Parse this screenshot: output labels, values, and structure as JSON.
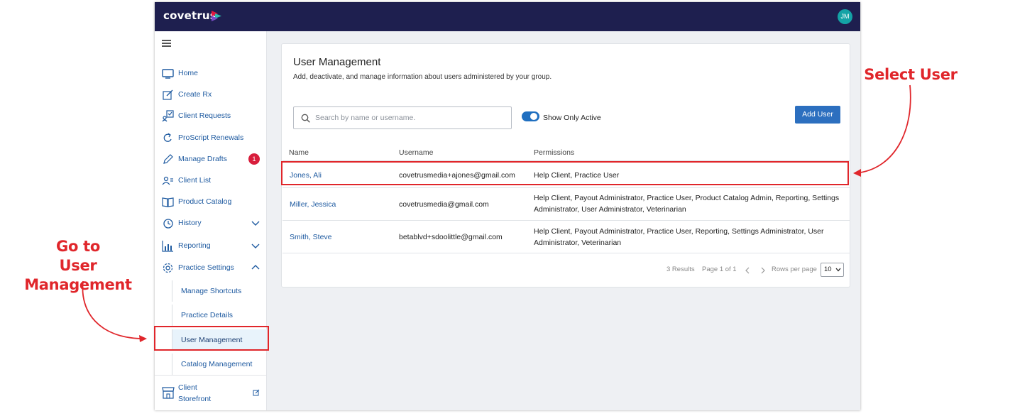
{
  "annotations": {
    "left_callout": "Go to\nUser Management",
    "left_line1": "Go to",
    "left_line2": "User Management",
    "right_callout": "Select User",
    "color": "#e0262b"
  },
  "header": {
    "logo_text": "covetrus",
    "avatar_initials": "JM"
  },
  "sidebar": {
    "items": [
      {
        "label": "Home",
        "icon": "monitor-icon"
      },
      {
        "label": "Create Rx",
        "icon": "edit-icon"
      },
      {
        "label": "Client Requests",
        "icon": "client-requests-icon"
      },
      {
        "label": "ProScript Renewals",
        "icon": "refresh-icon"
      },
      {
        "label": "Manage Drafts",
        "icon": "pencil-icon",
        "badge": "1"
      },
      {
        "label": "Client List",
        "icon": "users-icon"
      },
      {
        "label": "Product Catalog",
        "icon": "book-icon"
      },
      {
        "label": "History",
        "icon": "history-icon",
        "expandable": "chevron-down"
      },
      {
        "label": "Reporting",
        "icon": "bar-chart-icon",
        "expandable": "chevron-down"
      },
      {
        "label": "Practice Settings",
        "icon": "gear-icon",
        "expandable": "chevron-up"
      }
    ],
    "practice_settings_subitems": [
      {
        "label": "Manage Shortcuts"
      },
      {
        "label": "Practice Details"
      },
      {
        "label": "User Management",
        "active": true
      },
      {
        "label": "Catalog Management"
      }
    ],
    "storefront": {
      "label": "Client Storefront",
      "icon": "storefront-icon"
    }
  },
  "main": {
    "title": "User Management",
    "subtitle": "Add, deactivate, and manage information about users administered by your group.",
    "search_placeholder": "Search by name or username.",
    "toggle_label": "Show Only Active",
    "toggle_on": true,
    "add_button": "Add User",
    "table": {
      "columns": [
        "Name",
        "Username",
        "Permissions"
      ],
      "rows": [
        {
          "name": "Jones, Ali",
          "username": "covetrusmedia+ajones@gmail.com",
          "permissions": "Help Client, Practice User"
        },
        {
          "name": "Miller, Jessica",
          "username": "covetrusmedia@gmail.com",
          "permissions": "Help Client, Payout Administrator, Practice User, Product Catalog Admin, Reporting, Settings Administrator, User Administrator, Veterinarian"
        },
        {
          "name": "Smith, Steve",
          "username": "betablvd+sdoolittle@gmail.com",
          "permissions": "Help Client, Payout Administrator, Practice User, Reporting, Settings Administrator, User Administrator, Veterinarian"
        }
      ]
    },
    "pagination": {
      "results": "3 Results",
      "page": "Page 1 of 1",
      "rows_per_page_label": "Rows per page",
      "rows_per_page_value": "10"
    }
  },
  "colors": {
    "topbar": "#1e1f4f",
    "accent_blue": "#2c6fbf",
    "link_blue": "#1e5aa0",
    "badge_red": "#d81e3c",
    "avatar_teal": "#14a3a6"
  }
}
